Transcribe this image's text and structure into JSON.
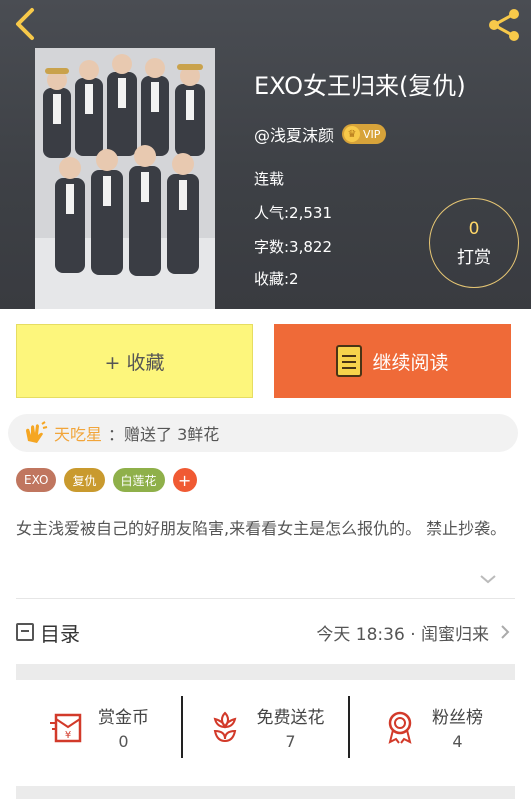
{
  "book": {
    "title": "EXO女王归来(复仇)",
    "author": "@浅夏沫颜",
    "vip_label": "VIP",
    "status": "连载",
    "popularity": "人气:2,531",
    "word_count": "字数:3,822",
    "favorites": "收藏:2",
    "cover_icon": "book-cover-image"
  },
  "reward": {
    "count": "0",
    "label": "打赏"
  },
  "actions": {
    "collect_label": "+ 收藏",
    "read_label": "继续阅读"
  },
  "gift": {
    "user": "天吃星",
    "message": "：赠送了 3鲜花"
  },
  "tags": [
    {
      "label": "EXO",
      "color": "#c0765f"
    },
    {
      "label": "复仇",
      "color": "#c99a2e"
    },
    {
      "label": "白莲花",
      "color": "#8fb04a"
    }
  ],
  "tag_add": "+",
  "intro": "女主浅爱被自己的好朋友陷害,来看看女主是怎么报仇的。          禁止抄袭。",
  "catalog": {
    "title": "目录",
    "latest_chapter": "今天 18:36 · 闺蜜归来"
  },
  "stats": [
    {
      "label": "赏金币",
      "value": "0",
      "icon": "red-envelope-icon"
    },
    {
      "label": "免费送花",
      "value": "7",
      "icon": "flower-icon"
    },
    {
      "label": "粉丝榜",
      "value": "4",
      "icon": "ribbon-medal-icon"
    }
  ],
  "colors": {
    "accent_orange": "#ef6a38",
    "collect_yellow": "#fdf67c",
    "header_bg": "#3e4146",
    "gift_user": "#f2a53a"
  }
}
